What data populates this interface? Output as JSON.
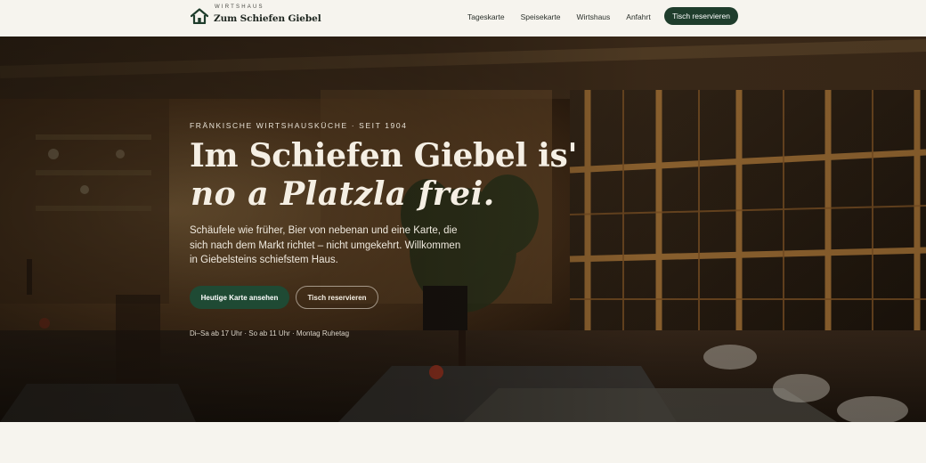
{
  "brand": {
    "eyebrow": "WIRTSHAUS",
    "name": "Zum Schiefen Giebel",
    "icon": "house-icon"
  },
  "nav": {
    "links": [
      "Tageskarte",
      "Speisekarte",
      "Wirtshaus",
      "Anfahrt"
    ],
    "cta": "Tisch reservieren"
  },
  "hero": {
    "eyebrow": "FRÄNKISCHE WIRTSHAUSKÜCHE · SEIT 1904",
    "title_line1": "Im Schiefen Giebel is'",
    "title_line2": "no a Platzla frei.",
    "lead": "Schäufele wie früher, Bier von nebenan und eine Karte, die sich nach dem Markt richtet – nicht umgekehrt. Willkommen in Giebelsteins schiefstem Haus.",
    "primary_button": "Heutige Karte ansehen",
    "secondary_button": "Tisch reservieren",
    "hours": "Di–Sa ab 17 Uhr · So ab 11 Uhr · Montag Ruhetag"
  },
  "colors": {
    "accent": "#1f3d2c",
    "background": "#f6f4ee",
    "hero_text": "#f5efe4"
  }
}
